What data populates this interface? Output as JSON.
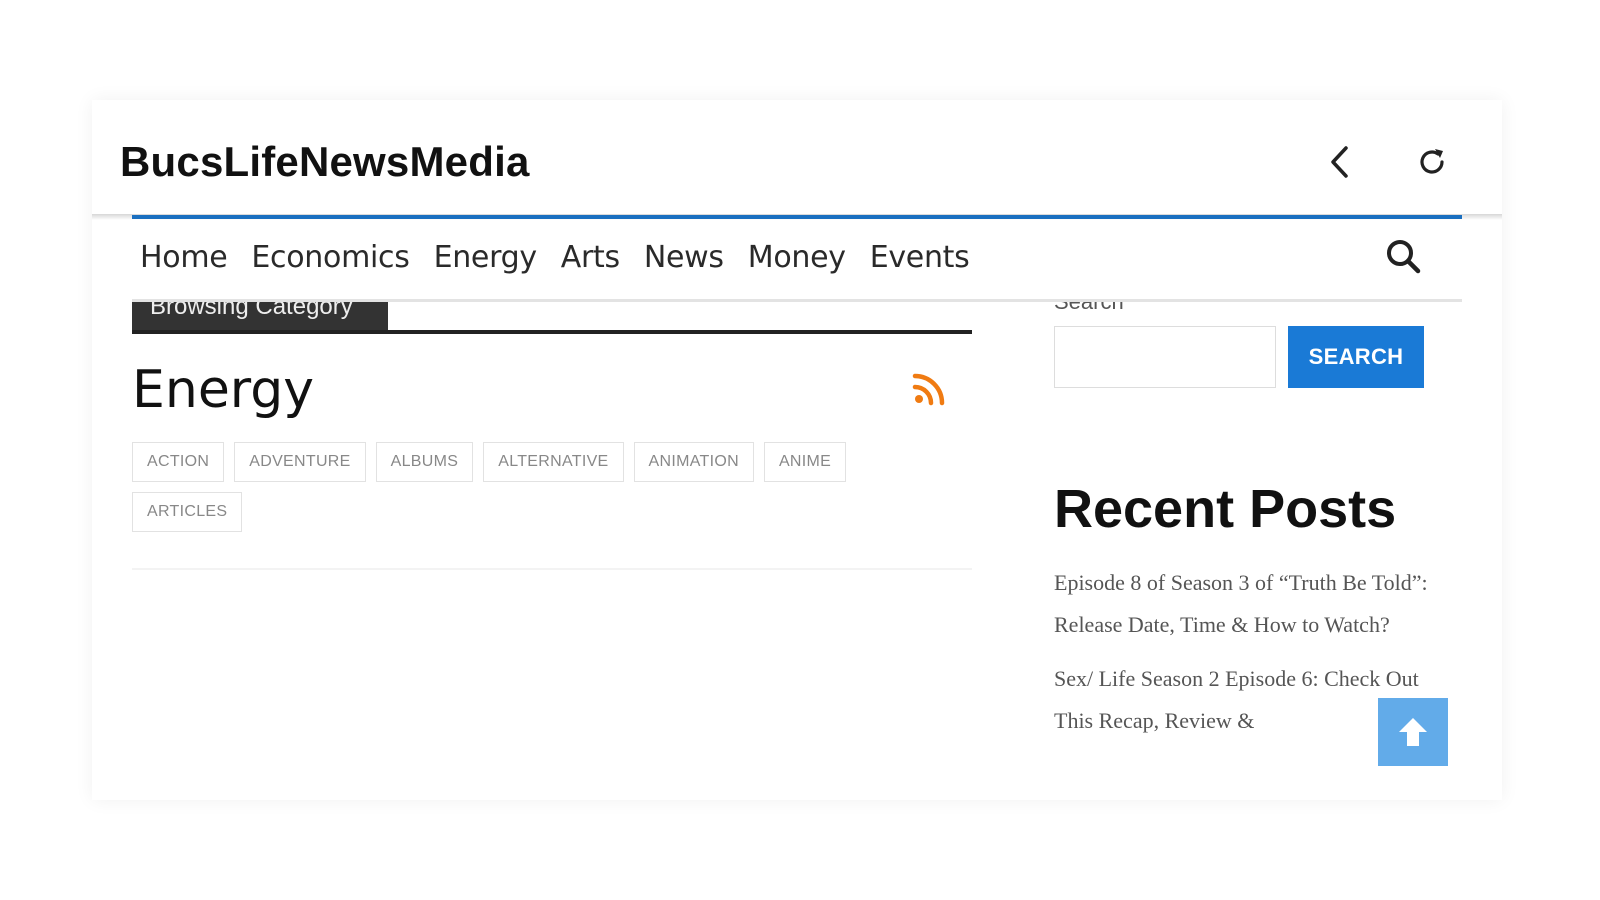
{
  "header": {
    "app_title": "BucsLifeNewsMedia"
  },
  "nav": {
    "items": [
      "Home",
      "Economics",
      "Energy",
      "Arts",
      "News",
      "Money",
      "Events"
    ]
  },
  "main": {
    "browsing_label": "Browsing Category",
    "category_title": "Energy",
    "tags": [
      "ACTION",
      "ADVENTURE",
      "ALBUMS",
      "ALTERNATIVE",
      "ANIMATION",
      "ANIME",
      "ARTICLES"
    ]
  },
  "sidebar": {
    "search_label": "Search",
    "search_value": "",
    "search_button": "SEARCH",
    "recent_title": "Recent Posts",
    "recent_posts": [
      "Episode 8 of Season 3 of “Truth Be Told”: Release Date, Time & How to Watch?",
      "Sex/ Life Season 2 Episode 6: Check Out This Recap, Review &"
    ]
  },
  "colors": {
    "accent_blue": "#1a6fc0",
    "search_button": "#1a7ad6",
    "rss_orange": "#f07b12",
    "scroll_top": "#5aa7e8"
  },
  "icons": {
    "back": "chevron-left-icon",
    "reload": "reload-icon",
    "search": "search-icon",
    "rss": "rss-icon",
    "to_top": "arrow-up-icon"
  }
}
